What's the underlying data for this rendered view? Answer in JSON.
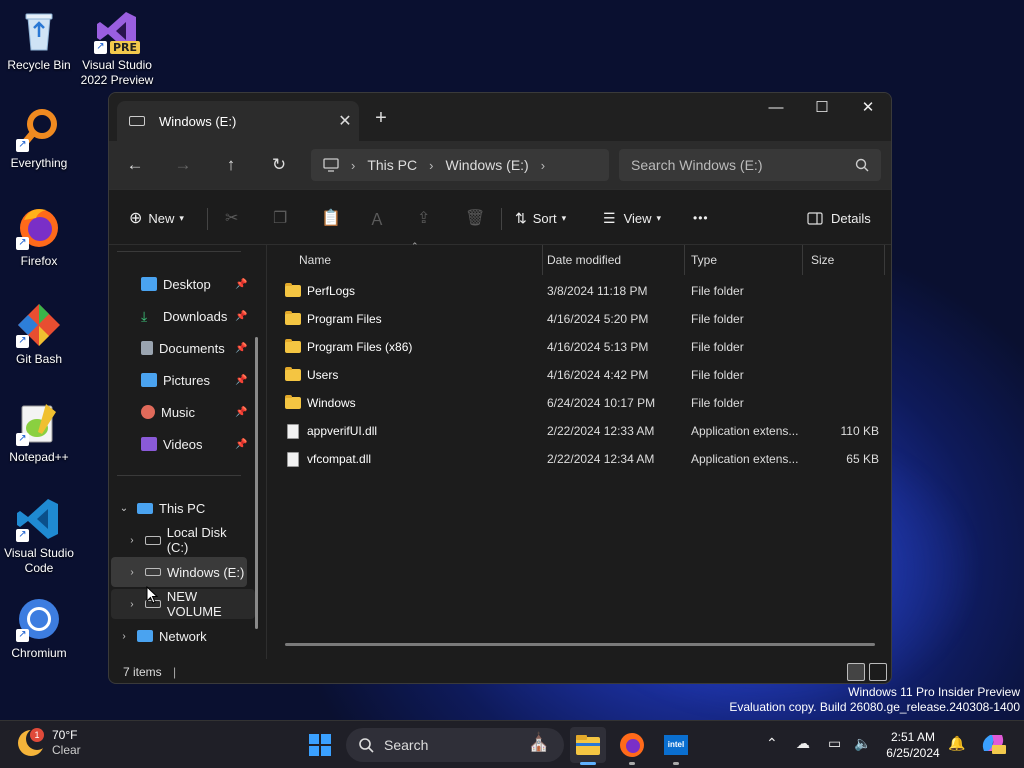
{
  "desktop": {
    "icons": [
      {
        "label": "Recycle Bin"
      },
      {
        "label": "Visual Studio 2022 Preview",
        "badge": "PRE"
      },
      {
        "label": "Everything"
      },
      {
        "label": "Firefox"
      },
      {
        "label": "Git Bash"
      },
      {
        "label": "Notepad++"
      },
      {
        "label": "Visual Studio Code"
      },
      {
        "label": "Chromium"
      }
    ],
    "watermark": {
      "line1": "Windows 11 Pro Insider Preview",
      "line2": "Evaluation copy. Build 26080.ge_release.240308-1400"
    }
  },
  "explorer": {
    "tab_title": "Windows (E:)",
    "breadcrumbs": [
      "This PC",
      "Windows (E:)"
    ],
    "search_placeholder": "Search Windows (E:)",
    "toolbar": {
      "new_label": "New",
      "sort_label": "Sort",
      "view_label": "View",
      "more_label": "•••",
      "details_label": "Details"
    },
    "nav": {
      "quick_access": [
        {
          "label": "Desktop",
          "icon": "desktop-icon",
          "color": "#4aa3f0"
        },
        {
          "label": "Downloads",
          "icon": "download-icon",
          "color": "#3cc47a"
        },
        {
          "label": "Documents",
          "icon": "document-icon",
          "color": "#9aa4b0"
        },
        {
          "label": "Pictures",
          "icon": "picture-icon",
          "color": "#4aa3f0"
        },
        {
          "label": "Music",
          "icon": "music-icon",
          "color": "#e06a5a"
        },
        {
          "label": "Videos",
          "icon": "video-icon",
          "color": "#8a5ad8"
        }
      ],
      "this_pc": "This PC",
      "drives": [
        "Local Disk (C:)",
        "Windows (E:)",
        "NEW VOLUME"
      ],
      "network": "Network"
    },
    "columns": {
      "name": "Name",
      "date": "Date modified",
      "type": "Type",
      "size": "Size"
    },
    "files": [
      {
        "name": "PerfLogs",
        "date": "3/8/2024 11:18 PM",
        "type": "File folder",
        "size": "",
        "kind": "folder"
      },
      {
        "name": "Program Files",
        "date": "4/16/2024 5:20 PM",
        "type": "File folder",
        "size": "",
        "kind": "folder"
      },
      {
        "name": "Program Files (x86)",
        "date": "4/16/2024 5:13 PM",
        "type": "File folder",
        "size": "",
        "kind": "folder"
      },
      {
        "name": "Users",
        "date": "4/16/2024 4:42 PM",
        "type": "File folder",
        "size": "",
        "kind": "folder"
      },
      {
        "name": "Windows",
        "date": "6/24/2024 10:17 PM",
        "type": "File folder",
        "size": "",
        "kind": "folder"
      },
      {
        "name": "appverifUI.dll",
        "date": "2/22/2024 12:33 AM",
        "type": "Application extens...",
        "size": "110 KB",
        "kind": "file"
      },
      {
        "name": "vfcompat.dll",
        "date": "2/22/2024 12:34 AM",
        "type": "Application extens...",
        "size": "65 KB",
        "kind": "file"
      }
    ],
    "status": "7 items"
  },
  "taskbar": {
    "weather_temp": "70°F",
    "weather_desc": "Clear",
    "weather_badge": "1",
    "search_label": "Search",
    "time": "2:51 AM",
    "date": "6/25/2024"
  }
}
